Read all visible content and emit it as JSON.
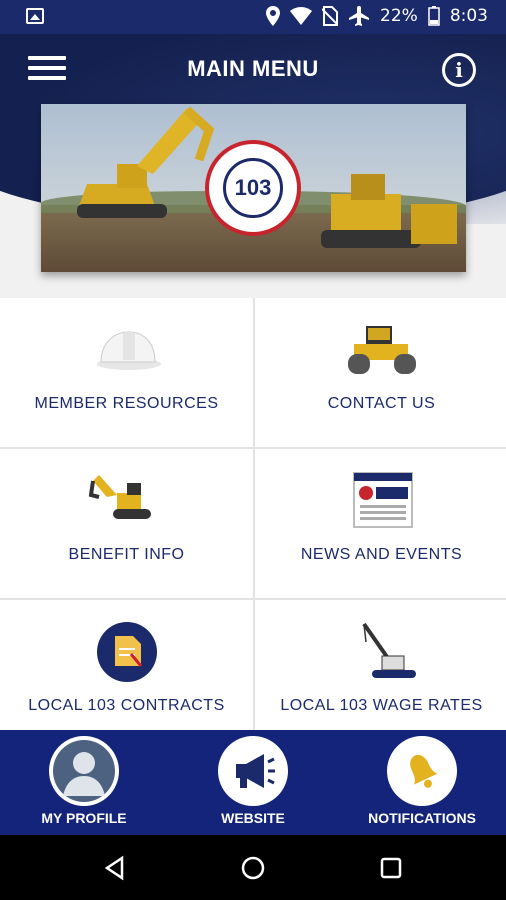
{
  "status_bar": {
    "battery": "22%",
    "time": "8:03",
    "icons": [
      "image-icon",
      "location-icon",
      "wifi-icon",
      "no-sim-icon",
      "airplane-icon",
      "battery-icon"
    ]
  },
  "header": {
    "title": "MAIN MENU",
    "info_symbol": "i",
    "seal_number": "103"
  },
  "menu_tiles": [
    {
      "label": "MEMBER RESOURCES",
      "icon": "hard-hat-icon"
    },
    {
      "label": "CONTACT US",
      "icon": "roller-compactor-icon"
    },
    {
      "label": "BENEFIT INFO",
      "icon": "excavator-icon"
    },
    {
      "label": "NEWS AND EVENTS",
      "icon": "newspaper-icon"
    },
    {
      "label": "LOCAL 103 CONTRACTS",
      "icon": "contract-document-icon"
    },
    {
      "label": "LOCAL 103 WAGE RATES",
      "icon": "crane-icon"
    }
  ],
  "bottom_tabs": [
    {
      "label": "MY PROFILE",
      "icon": "avatar-icon"
    },
    {
      "label": "WEBSITE",
      "icon": "megaphone-icon"
    },
    {
      "label": "NOTIFICATIONS",
      "icon": "bell-icon"
    }
  ],
  "colors": {
    "navy": "#14204f",
    "bottom_bar": "#14247a",
    "label_blue": "#1b2a6b",
    "seal_red": "#c8242d",
    "machine_yellow": "#e2b21f"
  },
  "news_word": "NEWS"
}
